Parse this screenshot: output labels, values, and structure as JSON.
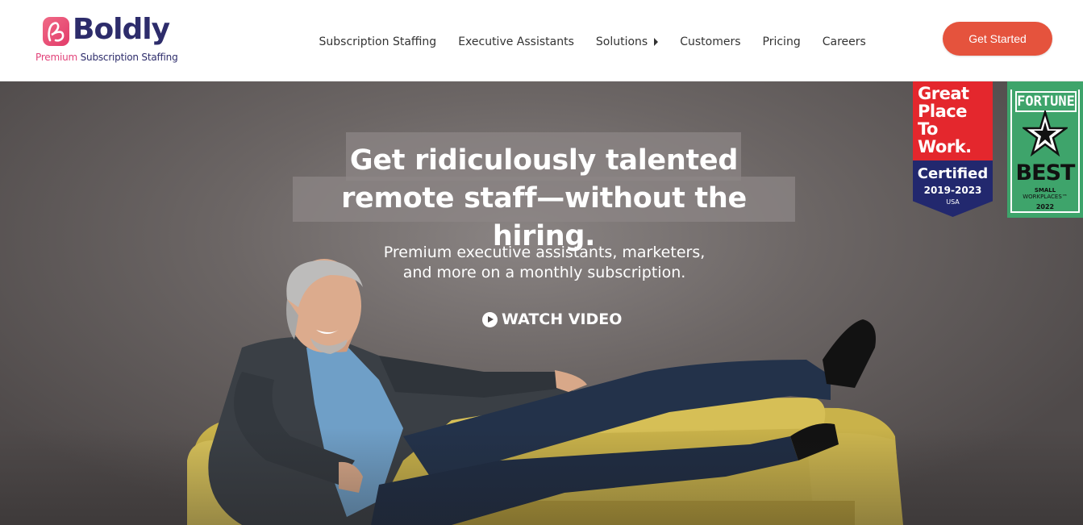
{
  "brand": {
    "name": "Boldly",
    "tagline_accent": "Premium",
    "tagline_rest": "Subscription Staffing",
    "colors": {
      "navy": "#2d2c6b",
      "pink": "#e2437a",
      "cta": "#e5533d"
    }
  },
  "nav": {
    "items": [
      {
        "label": "Subscription Staffing"
      },
      {
        "label": "Executive Assistants"
      },
      {
        "label": "Solutions",
        "has_submenu": true
      },
      {
        "label": "Customers"
      },
      {
        "label": "Pricing"
      },
      {
        "label": "Careers"
      }
    ]
  },
  "cta": {
    "label": "Get Started"
  },
  "hero": {
    "headline_line1": "Get ridiculously talented",
    "headline_line2": "remote staff—without the hiring.",
    "subline_line1": "Premium executive assistants, marketers,",
    "subline_line2": "and more on a monthly subscription.",
    "watch_label": "WATCH VIDEO",
    "image": "man-relaxing-on-yellow-couch"
  },
  "badges": {
    "gptw": {
      "line1": "Great",
      "line2": "Place",
      "line3": "To",
      "line4": "Work.",
      "certified": "Certified",
      "years": "2019-2023",
      "country": "USA",
      "colors": {
        "red": "#e4272d",
        "blue": "#22286e"
      }
    },
    "fortune": {
      "title": "FORTUNE",
      "best": "BEST",
      "small": "SMALL",
      "workplaces": "WORKPLACES™",
      "year": "2022",
      "color": "#3ea46b"
    }
  }
}
